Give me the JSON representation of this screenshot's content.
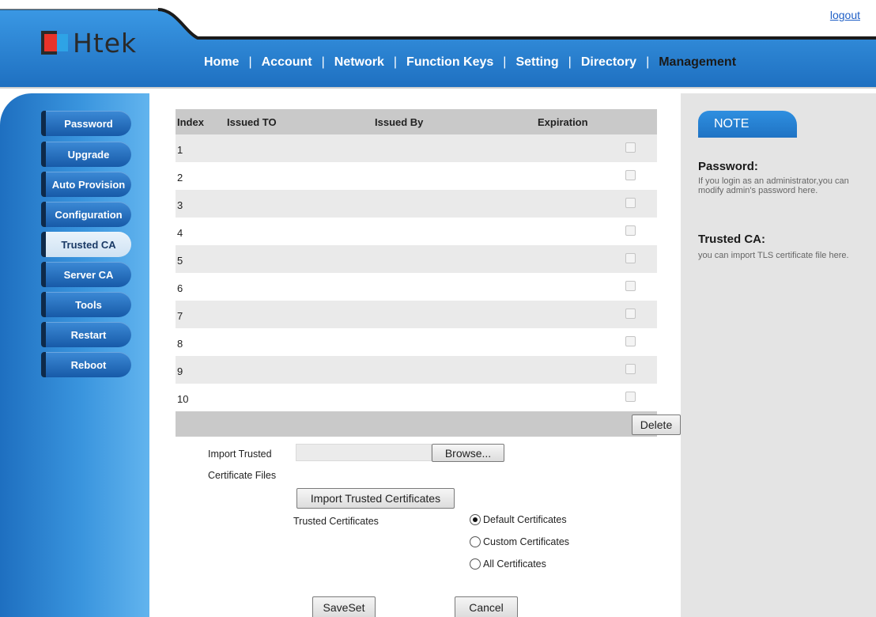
{
  "header": {
    "logout": "logout",
    "logo_text": "Htek",
    "nav": [
      {
        "label": "Home",
        "active": false
      },
      {
        "label": "Account",
        "active": false
      },
      {
        "label": "Network",
        "active": false
      },
      {
        "label": "Function Keys",
        "active": false
      },
      {
        "label": "Setting",
        "active": false
      },
      {
        "label": "Directory",
        "active": false
      },
      {
        "label": "Management",
        "active": true
      }
    ],
    "separator": "|"
  },
  "sidebar": {
    "items": [
      {
        "label": "Password",
        "active": false
      },
      {
        "label": "Upgrade",
        "active": false
      },
      {
        "label": "Auto Provision",
        "active": false
      },
      {
        "label": "Configuration",
        "active": false
      },
      {
        "label": "Trusted CA",
        "active": true
      },
      {
        "label": "Server CA",
        "active": false
      },
      {
        "label": "Tools",
        "active": false
      },
      {
        "label": "Restart",
        "active": false
      },
      {
        "label": "Reboot",
        "active": false
      }
    ]
  },
  "table": {
    "headers": {
      "index": "Index",
      "issued_to": "Issued TO",
      "issued_by": "Issued By",
      "expiration": "Expiration"
    },
    "rows": [
      "1",
      "2",
      "3",
      "4",
      "5",
      "6",
      "7",
      "8",
      "9",
      "10"
    ],
    "delete_label": "Delete"
  },
  "import": {
    "label_line1": "Import Trusted",
    "label_line2": "Certificate Files",
    "browse_label": "Browse...",
    "import_button": "Import Trusted Certificates",
    "trusted_label": "Trusted Certificates",
    "options": [
      {
        "label": "Default Certificates",
        "checked": true
      },
      {
        "label": "Custom Certificates",
        "checked": false
      },
      {
        "label": "All Certificates",
        "checked": false
      }
    ]
  },
  "actions": {
    "saveset": "SaveSet",
    "cancel": "Cancel"
  },
  "note": {
    "tab_label": "NOTE",
    "sections": [
      {
        "title": "Password:",
        "text": "If you login as an administrator,you can modify admin's password here."
      },
      {
        "title": "Trusted CA:",
        "text": "you can import TLS certificate file here."
      }
    ]
  },
  "colors": {
    "brand_blue": "#1f73c4",
    "logo_red": "#e8332a",
    "logo_blue": "#2ea3e6",
    "link": "#1f5fc6"
  }
}
